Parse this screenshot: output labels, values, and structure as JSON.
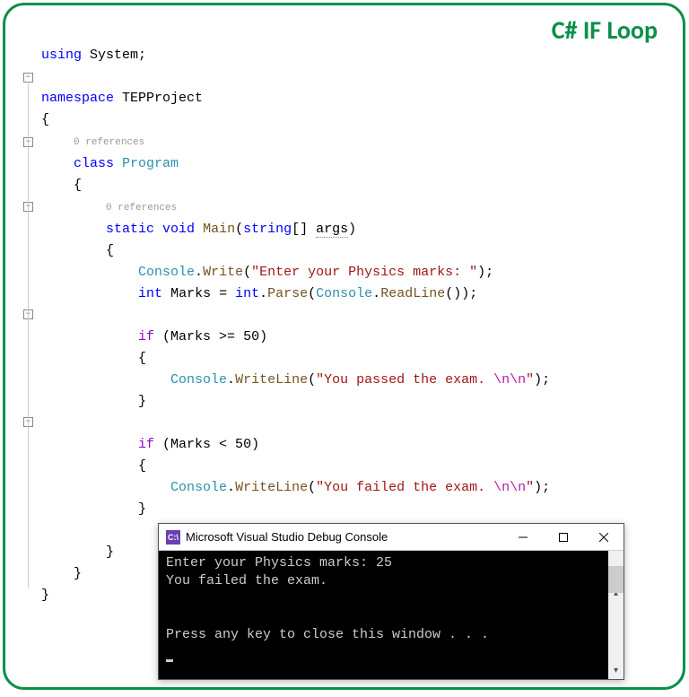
{
  "title": "C# IF Loop",
  "refs": "0 references",
  "code": {
    "using": "using",
    "system": "System",
    "semi": ";",
    "namespace": "namespace",
    "nsName": "TEPProject",
    "class": "class",
    "className": "Program",
    "static": "static",
    "void": "void",
    "main": "Main",
    "stringT": "string",
    "args": "args",
    "console": "Console",
    "write": "Write",
    "writeline": "WriteLine",
    "readline": "ReadLine",
    "promptStr": "\"Enter your Physics marks: \"",
    "intT": "int",
    "marks": "Marks",
    "intParse": "int",
    "parse": "Parse",
    "if": "if",
    "ge50": " (Marks >= 50)",
    "lt50": " (Marks < 50)",
    "passStr1": "\"You passed the exam. ",
    "passEsc": "\\n\\n",
    "passStr2": "\"",
    "failStr1": "\"You failed the exam. ",
    "failEsc": "\\n\\n",
    "failStr2": "\""
  },
  "console": {
    "iconText": "C:\\",
    "title": "Microsoft Visual Studio Debug Console",
    "line1": "Enter your Physics marks: 25",
    "line2": "You failed the exam.",
    "line3": "Press any key to close this window . . ."
  }
}
